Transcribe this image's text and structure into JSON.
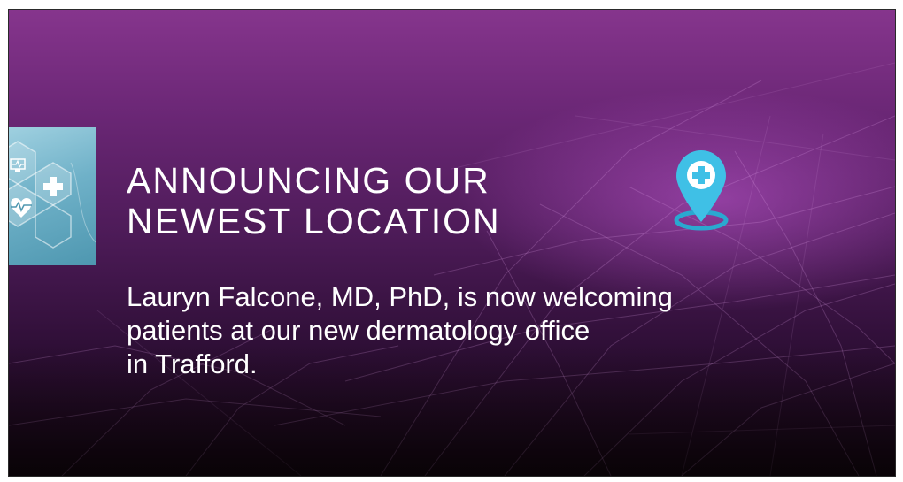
{
  "announcement": {
    "headline_lines": [
      "ANNOUNCING OUR",
      "NEWEST LOCATION"
    ],
    "body_lines": [
      "Lauryn Falcone, MD, PhD, is now welcoming",
      "patients at our new dermatology office",
      "in Trafford."
    ]
  },
  "icons": {
    "location_pin": "map-pin-plus-icon",
    "medical_panel": "medical-hexagons-icon"
  },
  "colors": {
    "background_top": "#86358d",
    "background_bottom": "#14060f",
    "pin": "#3fc0e6",
    "pin_ring": "#2aa8d0",
    "text": "#ffffff"
  }
}
